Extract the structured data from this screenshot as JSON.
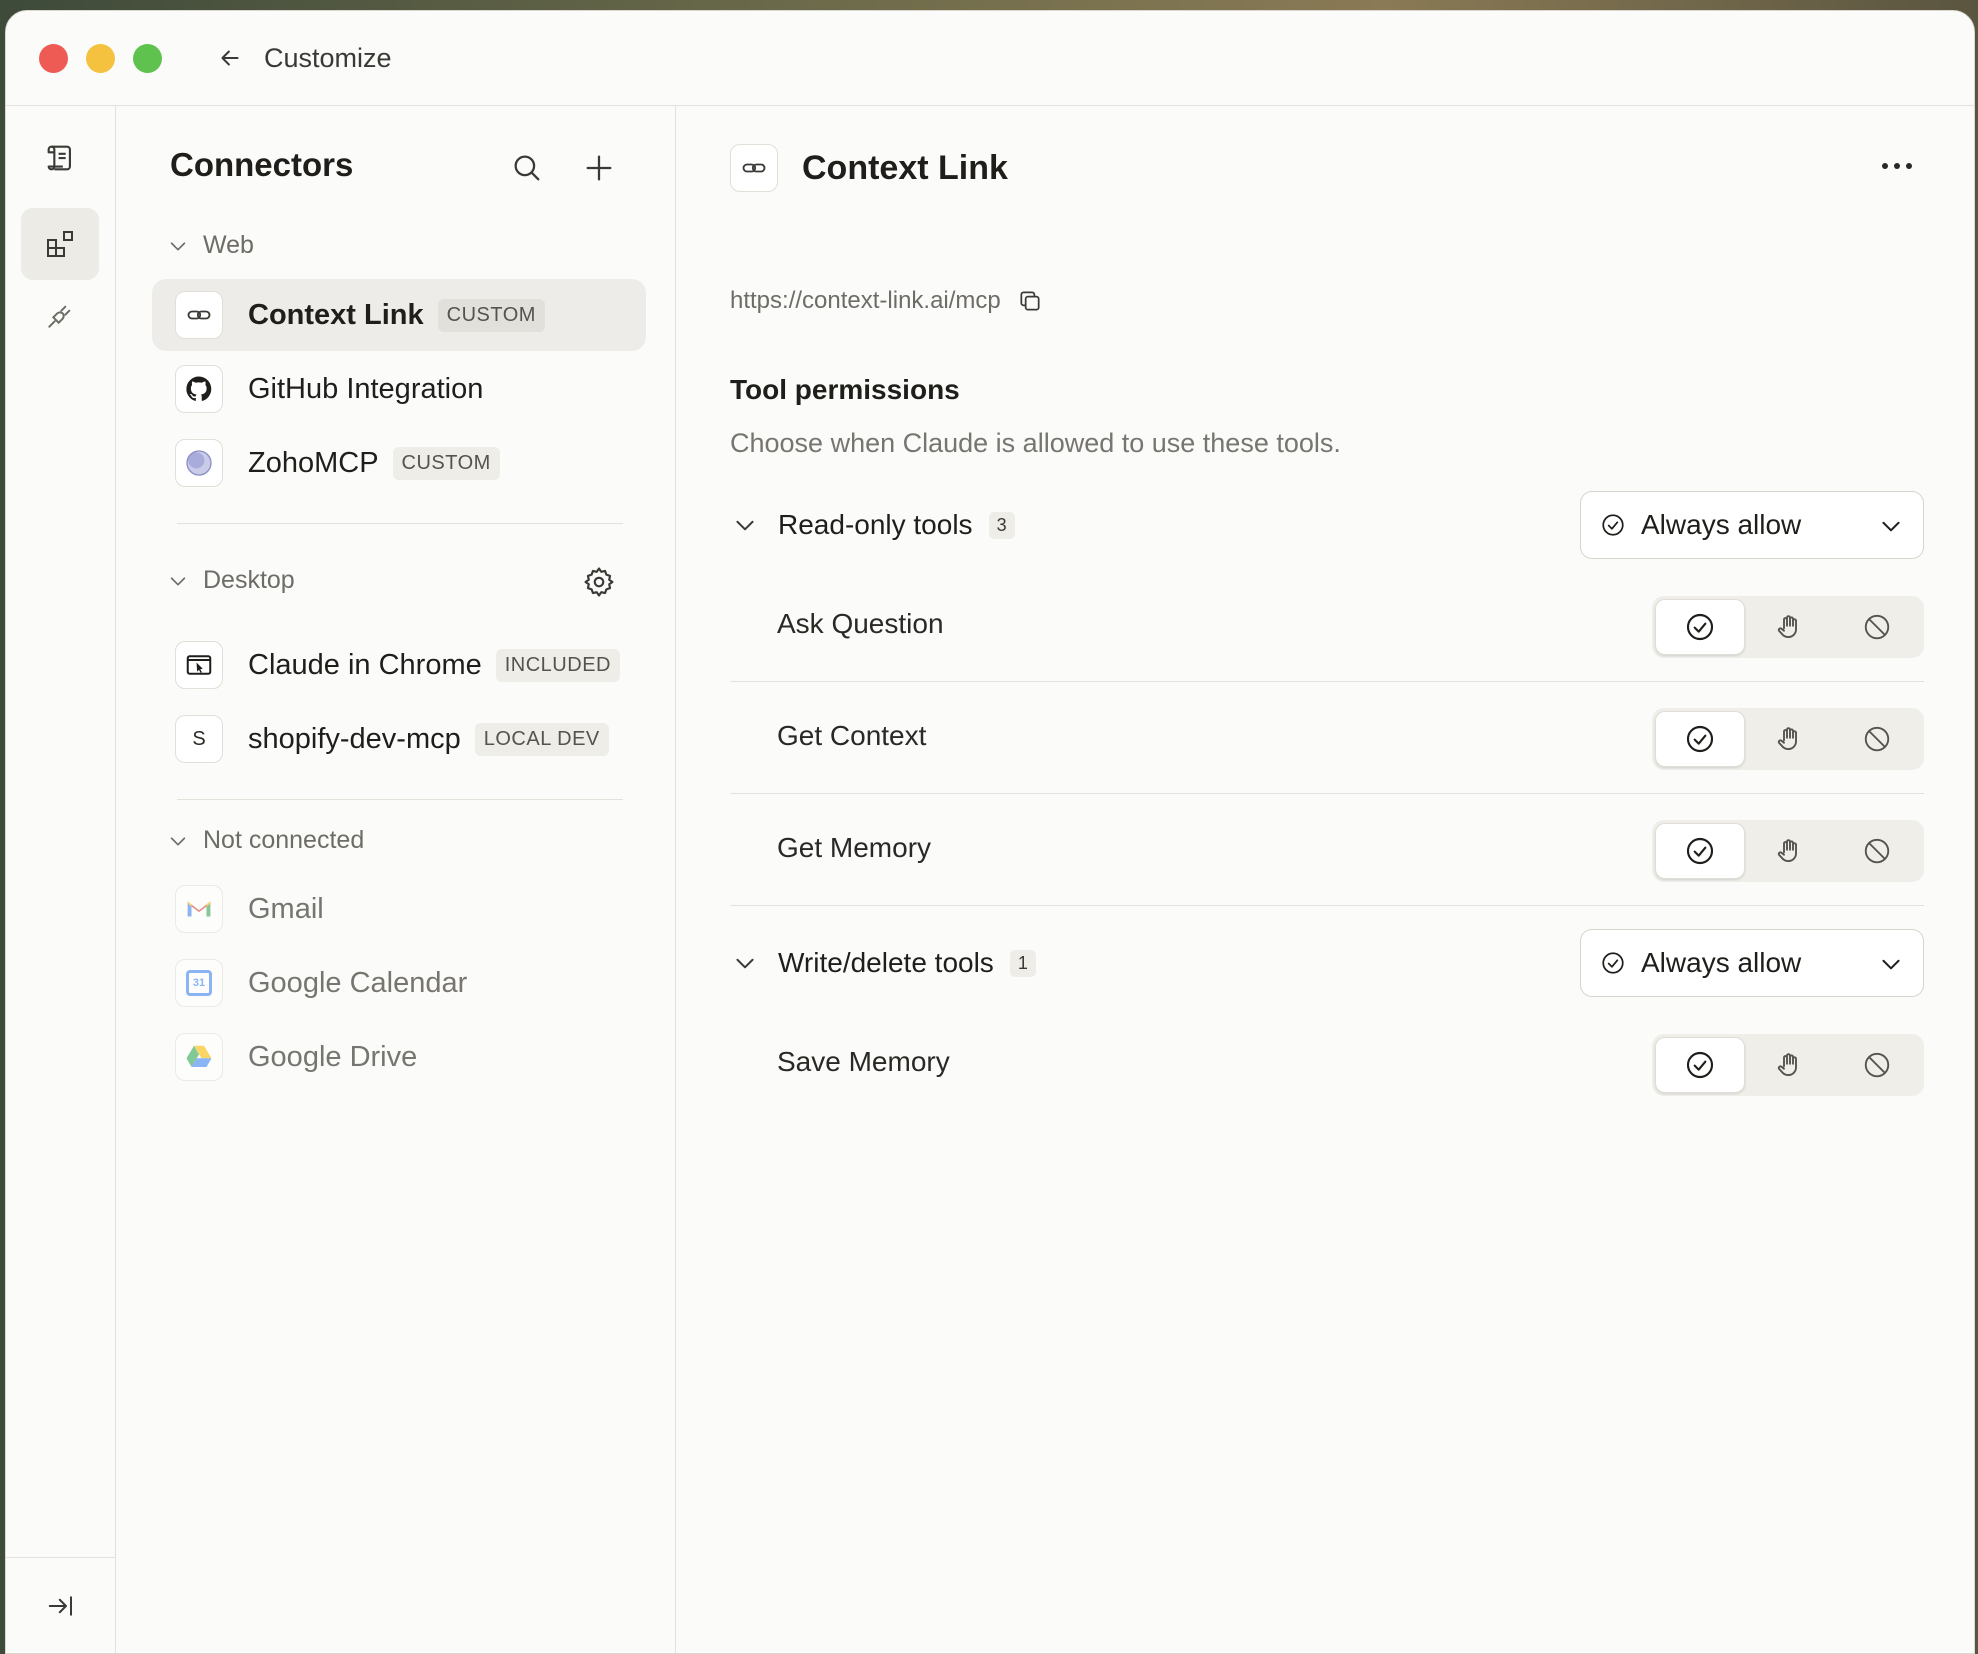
{
  "window": {
    "title": "Customize"
  },
  "sidebar": {
    "heading": "Connectors",
    "sections": {
      "web": {
        "label": "Web"
      },
      "desktop": {
        "label": "Desktop"
      },
      "not_connected": {
        "label": "Not connected"
      }
    },
    "web_items": [
      {
        "name": "Context Link",
        "tag": "CUSTOM",
        "icon": "link-icon"
      },
      {
        "name": "GitHub Integration",
        "tag": "",
        "icon": "github-icon"
      },
      {
        "name": "ZohoMCP",
        "tag": "CUSTOM",
        "icon": "globe-icon"
      }
    ],
    "desktop_items": [
      {
        "name": "Claude in Chrome",
        "tag": "INCLUDED",
        "icon": "browser-cursor-icon"
      },
      {
        "name": "shopify-dev-mcp",
        "tag": "LOCAL DEV",
        "icon": "letter-icon",
        "icon_letter": "S"
      }
    ],
    "not_connected_items": [
      {
        "name": "Gmail",
        "icon": "gmail-icon"
      },
      {
        "name": "Google Calendar",
        "icon": "google-calendar-icon",
        "icon_text": "31"
      },
      {
        "name": "Google Drive",
        "icon": "google-drive-icon"
      }
    ]
  },
  "main": {
    "title": "Context Link",
    "url": "https://context-link.ai/mcp",
    "permissions_title": "Tool permissions",
    "permissions_desc": "Choose when Claude is allowed to use these tools.",
    "groups": [
      {
        "name": "Read-only tools",
        "count": "3",
        "policy": "Always allow",
        "tools": [
          "Ask Question",
          "Get Context",
          "Get Memory"
        ]
      },
      {
        "name": "Write/delete tools",
        "count": "1",
        "policy": "Always allow",
        "tools": [
          "Save Memory"
        ]
      }
    ]
  },
  "colors": {
    "accent_red": "#ee5b55",
    "accent_yellow": "#f4c23f",
    "accent_green": "#5fc24f",
    "background": "#fbfbf9",
    "selected": "#edece8"
  }
}
